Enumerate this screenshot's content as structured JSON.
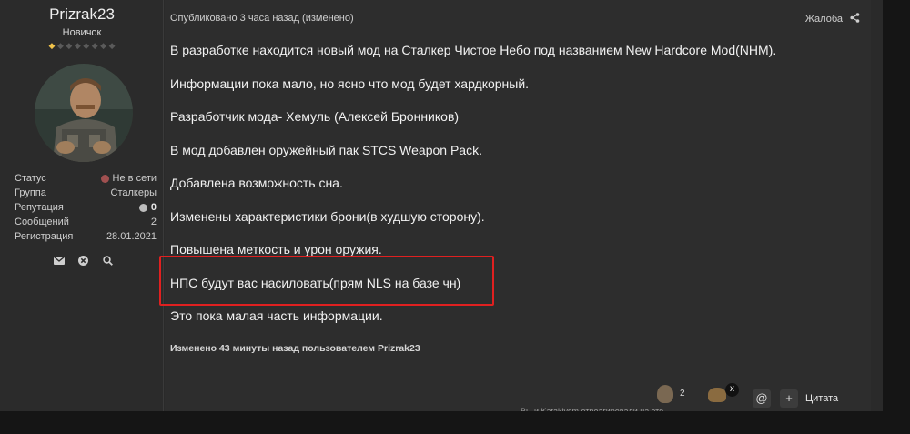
{
  "author": {
    "name": "Prizrak23",
    "title": "Новичок",
    "rank_filled": 1,
    "rank_total": 8,
    "stats": [
      {
        "key": "Статус",
        "value": "Не в сети",
        "indicator": "offline"
      },
      {
        "key": "Группа",
        "value": "Сталкеры"
      },
      {
        "key": "Репутация",
        "value": "0",
        "indicator": "reputation"
      },
      {
        "key": "Сообщений",
        "value": "2"
      },
      {
        "key": "Регистрация",
        "value": "28.01.2021"
      }
    ],
    "actions": [
      {
        "name": "message-icon"
      },
      {
        "name": "ignore-icon"
      },
      {
        "name": "search-icon"
      }
    ]
  },
  "post": {
    "meta": "Опубликовано 3 часа назад (изменено)",
    "report_label": "Жалоба",
    "paragraphs": [
      "В разработке находится новый мод на Сталкер Чистое Небо под названием New Hardcore Mod(NHM).",
      "Информации пока мало, но ясно что мод будет хардкорный.",
      "Разработчик мода- Хемуль (Алексей Бронников)",
      "В мод добавлен оружейный пак STCS Weapon Pack.",
      "Добавлена возможность сна.",
      "Изменены характеристики брони(в худшую сторону).",
      "Повышена меткость и урон оружия.",
      "НПС будут вас насиловать(прям NLS на базе чн)",
      "Это пока малая часть информации."
    ],
    "edited_note": "Изменено 43 минуты назад пользователем Prizrak23"
  },
  "reactions": {
    "count": "2",
    "close_label": "x",
    "mention_label": "@",
    "plus_label": "+",
    "quote_label": "Цитата",
    "reacted_text": "Вы и Kataklysm отреагировали на это"
  },
  "colors": {
    "highlight": "#e02020",
    "rank_gold": "#f0c24a",
    "offline_dot": "#a05050"
  }
}
